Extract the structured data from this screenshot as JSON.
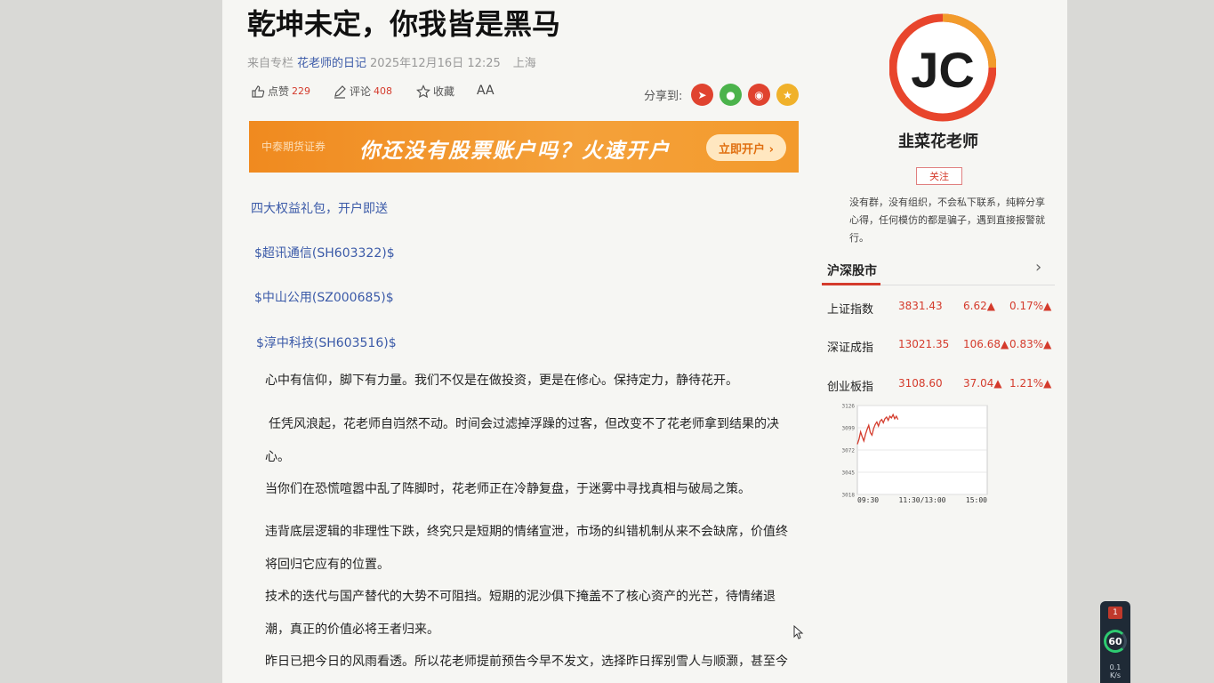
{
  "article": {
    "title": "乾坤未定，你我皆是黑马",
    "source_label": "来自专栏",
    "column": "花老师的日记",
    "date": "2025年12月16日 12:25",
    "location": "上海",
    "actions": {
      "like_label": "点赞",
      "like_count": "229",
      "comment_label": "评论",
      "comment_count": "408",
      "favorite_label": "收藏",
      "font_label": "AA"
    },
    "share_label": "分享到:",
    "share_icons": [
      "share-icon",
      "wechat-icon",
      "weibo-icon",
      "star-icon"
    ],
    "banner": {
      "brand": "中泰期货证券",
      "slogan": "你还没有股票账户吗？火速开户",
      "cta": "立即开户 ›"
    },
    "links": [
      "四大权益礼包，开户即送",
      "$超讯通信(SH603322)$",
      "$中山公用(SZ000685)$",
      "$淳中科技(SH603516)$"
    ],
    "paragraphs": [
      "心中有信仰，脚下有力量。我们不仅是在做投资，更是在修心。保持定力，静待花开。",
      "任凭风浪起，花老师自岿然不动。时间会过滤掉浮躁的过客，但改变不了花老师拿到结果的决心。",
      "当你们在恐慌喧嚣中乱了阵脚时，花老师正在冷静复盘，于迷雾中寻找真相与破局之策。",
      "违背底层逻辑的非理性下跌，终究只是短期的情绪宣泄，市场的纠错机制从来不会缺席，价值终将回归它应有的位置。",
      "技术的迭代与国产替代的大势不可阻挡。短期的泥沙俱下掩盖不了核心资产的光芒，待情绪退潮，真正的价值必将王者归来。",
      "昨日已把今日的风雨看透。所以花老师提前预告今早不发文，选择昨日挥别雪人与顺灏，甚至今"
    ]
  },
  "sidebar": {
    "logo_text": "JC",
    "user_name": "韭菜花老师",
    "follow_label": "关注",
    "bio": "没有群，没有组织，不会私下联系，纯粹分享心得，任何模仿的都是骗子，遇到直接报警就行。",
    "market_title": "沪深股市",
    "indices": [
      {
        "name": "上证指数",
        "value": "3831.43",
        "change": "6.62▲",
        "pct": "0.17%▲"
      },
      {
        "name": "深证成指",
        "value": "13021.35",
        "change": "106.68▲",
        "pct": "0.83%▲"
      },
      {
        "name": "创业板指",
        "value": "3108.60",
        "change": "37.04▲",
        "pct": "1.21%▲"
      }
    ]
  },
  "chart_data": {
    "type": "line",
    "x_ticks": [
      "09:30",
      "11:30/13:00",
      "15:00"
    ],
    "y_ticks": [
      "3126",
      "3099",
      "3072",
      "3045",
      "3018"
    ],
    "ylim": [
      3018,
      3126
    ],
    "x": [
      0,
      3,
      6,
      9,
      12,
      15,
      18,
      21,
      24,
      27,
      30,
      33,
      36,
      39,
      42,
      45,
      48,
      51,
      54,
      57,
      60,
      63,
      66,
      69,
      72,
      75
    ],
    "values": [
      3079,
      3085,
      3094,
      3088,
      3083,
      3091,
      3097,
      3102,
      3093,
      3090,
      3098,
      3103,
      3106,
      3101,
      3107,
      3109,
      3105,
      3110,
      3112,
      3108,
      3113,
      3111,
      3115,
      3110,
      3113,
      3109
    ],
    "x_total": 240,
    "line_color": "#d43b2c"
  },
  "system_widget": {
    "badge": "1",
    "fps": "60",
    "net_speed": "0.1",
    "net_unit": "K/s"
  }
}
